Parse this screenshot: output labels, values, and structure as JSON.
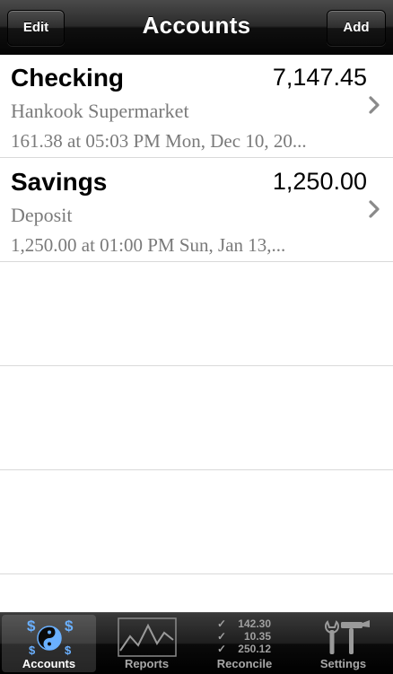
{
  "navbar": {
    "title": "Accounts",
    "edit_label": "Edit",
    "add_label": "Add"
  },
  "accounts": [
    {
      "name": "Checking",
      "balance": "7,147.45",
      "last_payee": "Hankook Supermarket",
      "last_detail": "161.38 at 05:03 PM Mon, Dec 10, 20..."
    },
    {
      "name": "Savings",
      "balance": "1,250.00",
      "last_payee": "Deposit",
      "last_detail": "1,250.00 at 01:00 PM Sun, Jan 13,..."
    }
  ],
  "tabs": [
    {
      "label": "Accounts",
      "icon": "yin-yang-dollar-icon",
      "selected": true
    },
    {
      "label": "Reports",
      "icon": "line-chart-icon",
      "selected": false
    },
    {
      "label": "Reconcile",
      "icon": "checklist-icon",
      "selected": false,
      "icon_values": [
        "142.30",
        "10.35",
        "250.12"
      ]
    },
    {
      "label": "Settings",
      "icon": "tools-icon",
      "selected": false
    }
  ],
  "colors": {
    "navbar": "#1a1a1a",
    "secondary_text": "#7a7a7a",
    "separator": "#d9d9d9",
    "tab_selected_text": "#ffffff",
    "tab_text": "#a8a8a8"
  }
}
